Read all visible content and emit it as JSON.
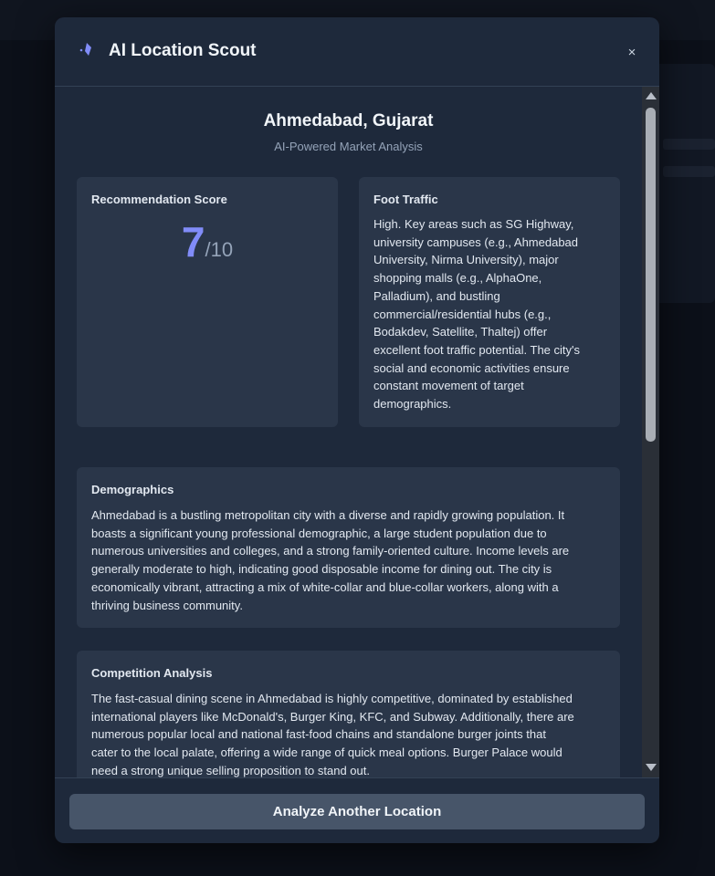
{
  "modal": {
    "title": "AI Location Scout",
    "close_label": "×"
  },
  "report": {
    "city": "Ahmedabad, Gujarat",
    "subtitle": "AI-Powered Market Analysis",
    "score": {
      "label": "Recommendation Score",
      "value": "7",
      "max": "/10"
    },
    "foot_traffic": {
      "title": "Foot Traffic",
      "lines": [
        "High. Key areas such as SG Highway,",
        "university campuses (e.g., Ahmedabad",
        "University, Nirma University), major",
        "shopping malls (e.g., AlphaOne,",
        "Palladium), and bustling",
        "commercial/residential hubs (e.g.,",
        "Bodakdev, Satellite, Thaltej) offer",
        "excellent foot traffic potential. The city's",
        "social and economic activities ensure",
        "constant movement of target",
        "demographics."
      ]
    },
    "demographics": {
      "title": "Demographics",
      "lines": [
        "Ahmedabad is a bustling metropolitan city with a diverse and rapidly growing population. It",
        "boasts a significant young professional demographic, a large student population due to",
        "numerous universities and colleges, and a strong family-oriented culture. Income levels are",
        "generally moderate to high, indicating good disposable income for dining out. The city is",
        "economically vibrant, attracting a mix of white-collar and blue-collar workers, along with a",
        "thriving business community."
      ]
    },
    "competition": {
      "title": "Competition Analysis",
      "lines": [
        "The fast-casual dining scene in Ahmedabad is highly competitive, dominated by established",
        "international players like McDonald's, Burger King, KFC, and Subway. Additionally, there are",
        "numerous popular local and national fast-food chains and standalone burger joints that",
        "cater to the local palate, offering a wide range of quick meal options. Burger Palace would",
        "need a strong unique selling proposition to stand out."
      ]
    }
  },
  "footer": {
    "button_label": "Analyze Another Location"
  },
  "colors": {
    "accent": "#818cf8",
    "modal_bg": "#1e293b",
    "card_bg": "#2a3649",
    "button_bg": "#475569"
  }
}
